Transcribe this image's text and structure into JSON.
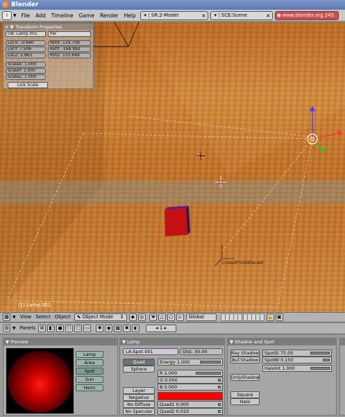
{
  "window": {
    "title": "Blender"
  },
  "menubar": {
    "menus": [
      "File",
      "Add",
      "Timeline",
      "Game",
      "Render",
      "Help"
    ],
    "screen_field": "SR:2-Model",
    "scene_field": "SCE:Scene",
    "url": "www.blender.org 245"
  },
  "transform_panel": {
    "title": "Transform Properties",
    "ob_name": "OB: Lamp.001",
    "par": "Par",
    "loc_x": "LocX: -0.640",
    "loc_y": "LocY: 7.506",
    "loc_z": "LocZ: 2.862",
    "rot_x": "RotX: 119.708",
    "rot_y": "RotY: -168.992",
    "rot_z": "RotZ: 133.649",
    "scale_x": "ScaleX: 1.000",
    "scale_y": "ScaleY: 1.000",
    "scale_z": "ScaleZ: 1.000",
    "link_scale": "Link Scale"
  },
  "viewport": {
    "status": "(1) Lamp.001",
    "lamp_label": "LinkedPrintWhereAt"
  },
  "view_header": {
    "menus": [
      "View",
      "Select",
      "Object"
    ],
    "mode": "Object Mode",
    "orientation": "Global"
  },
  "buttons_header": {
    "panels_label": "Panels",
    "frame": "1"
  },
  "preview_panel": {
    "title": "Preview",
    "buttons": [
      "Lamp",
      "Area",
      "Spot",
      "Sun",
      "Hemi"
    ],
    "active": "Spot"
  },
  "lamp_panel": {
    "title": "Lamp",
    "name_field": "LA:Spot.001",
    "dist": "Dist: 30.00",
    "quad": "Quad",
    "sphere": "Sphere",
    "energy": "Energy 1.000",
    "r": "R 1.000",
    "g": "G 0.000",
    "b": "B 0.000",
    "layer": "Layer",
    "negative": "Negative",
    "no_diffuse": "No Diffuse",
    "no_specular": "No Specular",
    "quad1": "Quad1 0.000",
    "quad2": "Quad2 0.010",
    "color": "#ff0000"
  },
  "shadow_panel": {
    "title": "Shadow and Spot",
    "ray_shadow": "Ray Shadow",
    "buf_shadow": "Buf.Shadow",
    "only_shadow": "OnlyShadow",
    "square": "Square",
    "halo": "Halo",
    "spot_si": "SpotSi 75.00",
    "spot_bl": "SpotBl 0.150",
    "halo_int": "HaloInt 1.000"
  }
}
